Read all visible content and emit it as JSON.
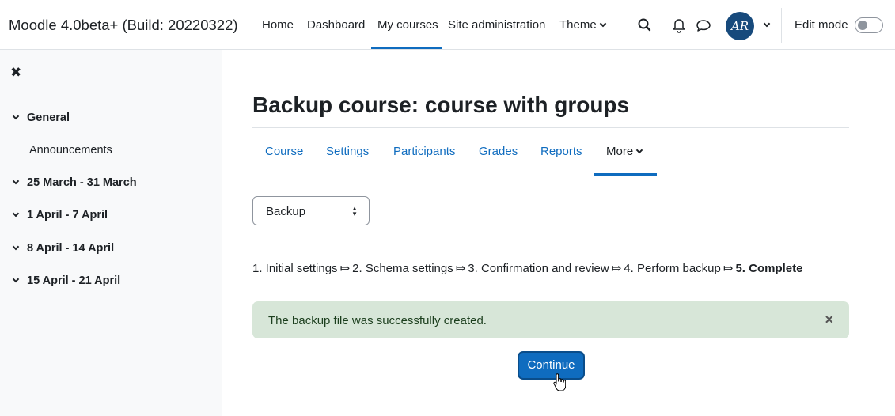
{
  "navbar": {
    "brand": "Moodle 4.0beta+ (Build: 20220322)",
    "links": [
      {
        "label": "Home"
      },
      {
        "label": "Dashboard"
      },
      {
        "label": "My courses",
        "active": true
      },
      {
        "label": "Site administration"
      },
      {
        "label": "Theme",
        "dropdown": true
      }
    ],
    "icons": [
      "search-icon",
      "bell-icon",
      "chat-icon"
    ],
    "avatar_initials": "AR",
    "edit_mode_label": "Edit mode",
    "edit_mode_on": false
  },
  "drawer": {
    "close_icon": "✖",
    "sections": [
      {
        "label": "General",
        "expanded": true,
        "items": [
          "Announcements"
        ]
      },
      {
        "label": "25 March - 31 March",
        "expanded": true
      },
      {
        "label": "1 April - 7 April",
        "expanded": true
      },
      {
        "label": "8 April - 14 April",
        "expanded": true
      },
      {
        "label": "15 April - 21 April",
        "expanded": true
      }
    ]
  },
  "main": {
    "title": "Backup course: course with groups",
    "tabs": [
      {
        "label": "Course"
      },
      {
        "label": "Settings"
      },
      {
        "label": "Participants"
      },
      {
        "label": "Grades"
      },
      {
        "label": "Reports"
      },
      {
        "label": "More",
        "active": true,
        "dropdown": true
      }
    ],
    "select_value": "Backup",
    "progress": {
      "steps": [
        "1. Initial settings",
        "2. Schema settings",
        "3. Confirmation and review",
        "4. Perform backup",
        "5. Complete"
      ],
      "separator": "⤇",
      "current": "5. Complete"
    },
    "alert": {
      "message": "The backup file was successfully created.",
      "close_glyph": "×"
    },
    "continue_label": "Continue"
  },
  "colors": {
    "primary": "#0f6cbf",
    "success_bg": "#d7e6d8",
    "drawer_bg": "#f8f9fa",
    "avatar_bg": "#174a7c"
  }
}
